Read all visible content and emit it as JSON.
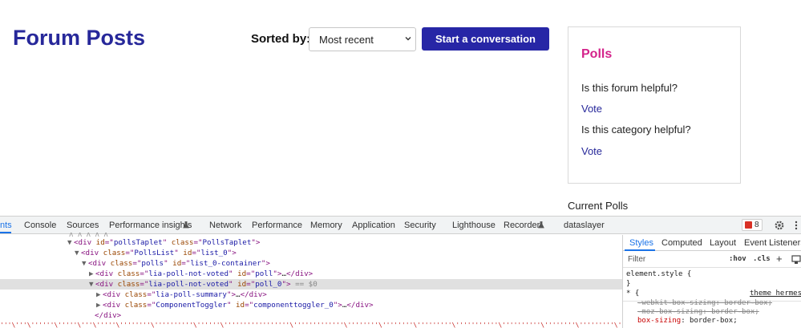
{
  "page": {
    "title": "Forum Posts",
    "sort_label": "Sorted by:",
    "sort_value": "Most recent",
    "start_button": "Start a conversation"
  },
  "polls": {
    "title": "Polls",
    "items": [
      {
        "question": "Is this forum helpful?",
        "vote": "Vote"
      },
      {
        "question": "Is this category helpful?",
        "vote": "Vote"
      }
    ],
    "current_polls": "Current Polls"
  },
  "devtools": {
    "tabs": [
      "nts",
      "Console",
      "Sources",
      "Performance insights",
      "Network",
      "Performance",
      "Memory",
      "Application",
      "Security",
      "Lighthouse",
      "Recorder",
      "dataslayer"
    ],
    "issues_count": "8",
    "elements": [
      {
        "tag": "div",
        "attrs": [
          [
            "id",
            "pollsTaplet"
          ],
          [
            "class",
            "PollsTaplet"
          ]
        ],
        "collapsed": false,
        "close": false
      },
      {
        "tag": "div",
        "attrs": [
          [
            "class",
            "PollsList"
          ],
          [
            "id",
            "list_0"
          ]
        ],
        "collapsed": false,
        "close": false
      },
      {
        "tag": "div",
        "attrs": [
          [
            "class",
            "polls"
          ],
          [
            "id",
            "list_0-container"
          ]
        ],
        "collapsed": false,
        "close": false
      },
      {
        "tag": "div",
        "attrs": [
          [
            "class",
            "lia-poll-not-voted"
          ],
          [
            "id",
            "poll"
          ]
        ],
        "collapsed": true,
        "close": true
      },
      {
        "tag": "div",
        "attrs": [
          [
            "class",
            "lia-poll-not-voted"
          ],
          [
            "id",
            "poll_0"
          ]
        ],
        "collapsed": false,
        "close": false,
        "selected": true,
        "ref": "== $0"
      },
      {
        "tag": "div",
        "attrs": [
          [
            "class",
            "lia-poll-summary"
          ]
        ],
        "collapsed": true,
        "close": true
      },
      {
        "tag": "div",
        "attrs": [
          [
            "class",
            "ComponentToggler"
          ],
          [
            "id",
            "componenttoggler_0"
          ]
        ],
        "collapsed": true,
        "close": true
      },
      {
        "closing": "</div>"
      }
    ],
    "styles_tabs": [
      "Styles",
      "Computed",
      "Layout",
      "Event Listeners"
    ],
    "filter_placeholder": "Filter",
    "hov": ":hov",
    "cls": ".cls",
    "element_style": "element.style {",
    "close_brace": "}",
    "rule_selector": "* {",
    "rule_source": "theme_hermes.",
    "declarations": [
      {
        "prop": "-webkit-box-sizing",
        "value": "border-box;",
        "struck": true
      },
      {
        "prop": "-moz-box-sizing",
        "value": "border-box;",
        "struck": true
      },
      {
        "prop": "box-sizing",
        "value": "border-box;",
        "struck": false
      }
    ]
  }
}
